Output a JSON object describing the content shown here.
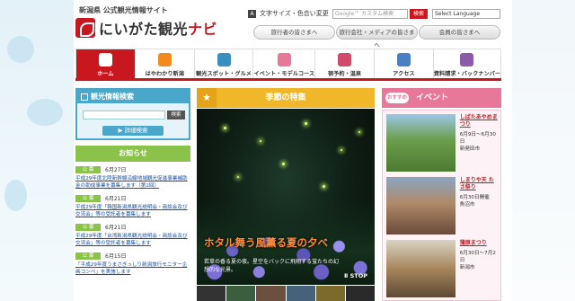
{
  "header": {
    "logo_sub": "新潟県 公式観光情報サイト",
    "logo_main": "にいがた観光",
    "logo_accent": "ナビ",
    "font_size_label": "文字サイズ・色合い変更",
    "search_placeholder": "Google™ カスタム検索",
    "search_button": "検索",
    "language_select": "Select Language",
    "audience_buttons": [
      "旅行者の皆さまへ",
      "旅行会社・メディアの皆さまへ",
      "会員の皆さまへ"
    ]
  },
  "nav": {
    "items": [
      {
        "label": "ホーム",
        "icon": "home-icon",
        "color": "#c8171e"
      },
      {
        "label": "はやわかり新潟",
        "icon": "map-icon",
        "color": "#f08c1e"
      },
      {
        "label": "観光スポット・グルメ",
        "icon": "spot-icon",
        "color": "#3a8fc1"
      },
      {
        "label": "イベント・モデルコース",
        "icon": "calendar-icon",
        "color": "#e8789a"
      },
      {
        "label": "宿予約・温泉",
        "icon": "onsen-icon",
        "color": "#d24a6b"
      },
      {
        "label": "アクセス",
        "icon": "train-icon",
        "color": "#4a7fc1"
      },
      {
        "label": "資料請求・バックナンバー",
        "icon": "book-icon",
        "color": "#8b5aa8"
      }
    ]
  },
  "search_panel": {
    "title": "観光情報検索",
    "button": "検索",
    "detail_button": "▶ 詳細検索"
  },
  "notices": {
    "title": "お知らせ",
    "items": [
      {
        "badge": "公 募",
        "date": "6月27日",
        "text": "平成29年度北陸新幹線沿線地域観光促進事業補助金の助成事業を募集します（第2回）"
      },
      {
        "badge": "公 募",
        "date": "6月21日",
        "text": "平成29年度「韓国新潟県観光説明会・商談会及び交流会」等の受託者を募集します"
      },
      {
        "badge": "公 募",
        "date": "6月21日",
        "text": "平成29年度「台湾新潟県観光説明会・商談会及び交流会」等の受託者を募集します"
      },
      {
        "badge": "公 募",
        "date": "6月15日",
        "text": "「平成29年度うまさぎっしり新潟旅行モニター企画コンペ」を実施します"
      }
    ]
  },
  "season": {
    "title": "季節の特集",
    "feature_title": "ホタル舞う風薫る夏の夕べ",
    "feature_desc": "若草の香る夏の夜。星空をバックに飛翔する蛍たちの幻想的な光景。",
    "stop_label": "Ⅱ STOP"
  },
  "events": {
    "badge": "おすすめ",
    "title": "イベント",
    "items": [
      {
        "title": "しばたあやめまつり",
        "date": "6月9日〜6月30日",
        "place": "新発田市",
        "photo_color": "#5b8a3c"
      },
      {
        "title": "しまりや天 たさ祭り",
        "date": "6月30日開催",
        "place": "魚沼市",
        "photo_color": "#8b6a4a"
      },
      {
        "title": "蒲原まつり",
        "date": "6月30日〜7月2日",
        "place": "新潟市"
      }
    ]
  },
  "colors": {
    "brand": "#c8171e",
    "season": "#f1b72a",
    "event": "#e8789a",
    "notice": "#8bc34a",
    "search": "#4aa7c9"
  }
}
